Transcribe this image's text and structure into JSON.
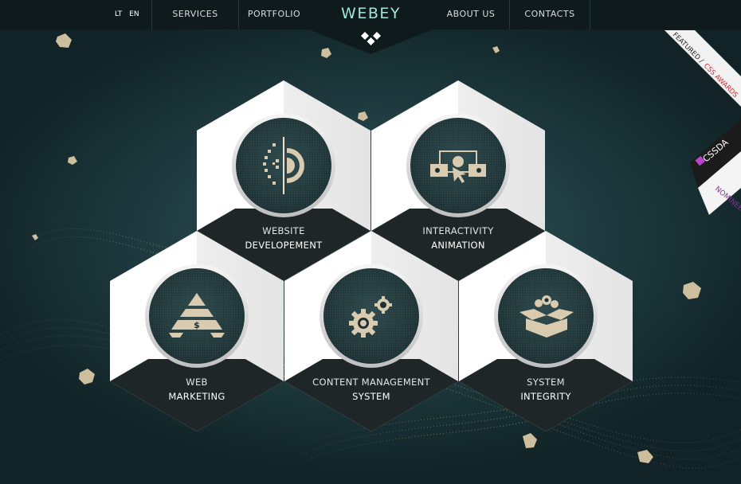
{
  "nav": {
    "lang_lt": "LT",
    "lang_en": "EN",
    "services": "SERVICES",
    "portfolio": "PORTFOLIO",
    "logo": "WEBEY",
    "about": "ABOUT US",
    "contacts": "CONTACTS"
  },
  "services": [
    {
      "line1": "WEBSITE",
      "line2": "DEVELOPEMENT",
      "icon": "code-icon"
    },
    {
      "line1": "INTERACTIVITY",
      "line2": "ANIMATION",
      "icon": "interactive-icon"
    },
    {
      "line1": "WEB",
      "line2": "MARKETING",
      "icon": "marketing-pyramid-icon"
    },
    {
      "line1": "CONTENT MANAGEMENT",
      "line2": "SYSTEM",
      "icon": "gears-icon"
    },
    {
      "line1": "SYSTEM",
      "line2": "INTEGRITY",
      "icon": "box-icon"
    }
  ],
  "badges": {
    "featured": "FEATURED /",
    "cssawards": "CSS AWARDS",
    "cssda": "CSSDA",
    "nominee": "NOMINEE"
  },
  "colors": {
    "accent": "#9fe6dc",
    "background": "#1b3236",
    "nav": "#0f1a1c",
    "hex_light": "#ffffff",
    "hex_dark": "#1e2627",
    "icon_gold": "#d8cbb0",
    "cssawards_red": "#d2272e",
    "nominee_purple": "#7a3a8e"
  }
}
